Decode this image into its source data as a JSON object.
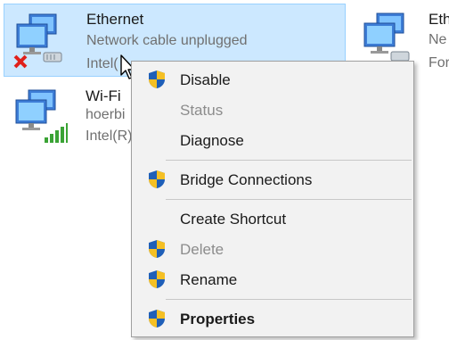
{
  "connections": [
    {
      "name": "Ethernet",
      "status": "Network cable unplugged",
      "device": "Intel("
    },
    {
      "name": "Wi-Fi",
      "status": "hoerbi",
      "device": "Intel(R)"
    },
    {
      "name": "Eth",
      "status": "Ne",
      "device": "For"
    }
  ],
  "context_menu": {
    "items": [
      {
        "label": "Disable",
        "shield": true,
        "enabled": true,
        "bold": false
      },
      {
        "label": "Status",
        "shield": false,
        "enabled": false,
        "bold": false
      },
      {
        "label": "Diagnose",
        "shield": false,
        "enabled": true,
        "bold": false
      },
      {
        "label": "Bridge Connections",
        "shield": true,
        "enabled": true,
        "bold": false
      },
      {
        "label": "Create Shortcut",
        "shield": false,
        "enabled": true,
        "bold": false
      },
      {
        "label": "Delete",
        "shield": true,
        "enabled": false,
        "bold": false
      },
      {
        "label": "Rename",
        "shield": true,
        "enabled": true,
        "bold": false
      },
      {
        "label": "Properties",
        "shield": true,
        "enabled": true,
        "bold": true
      }
    ]
  },
  "colors": {
    "selection_fill": "#cce8ff",
    "selection_border": "#99d1ff",
    "menu_background": "#f2f2f2",
    "disabled_text": "#8c8c8c"
  },
  "icons": [
    "network-computers-icon",
    "disconnected-x-icon",
    "cable-plug-icon",
    "wifi-signal-icon",
    "uac-shield-icon",
    "mouse-cursor-icon"
  ]
}
